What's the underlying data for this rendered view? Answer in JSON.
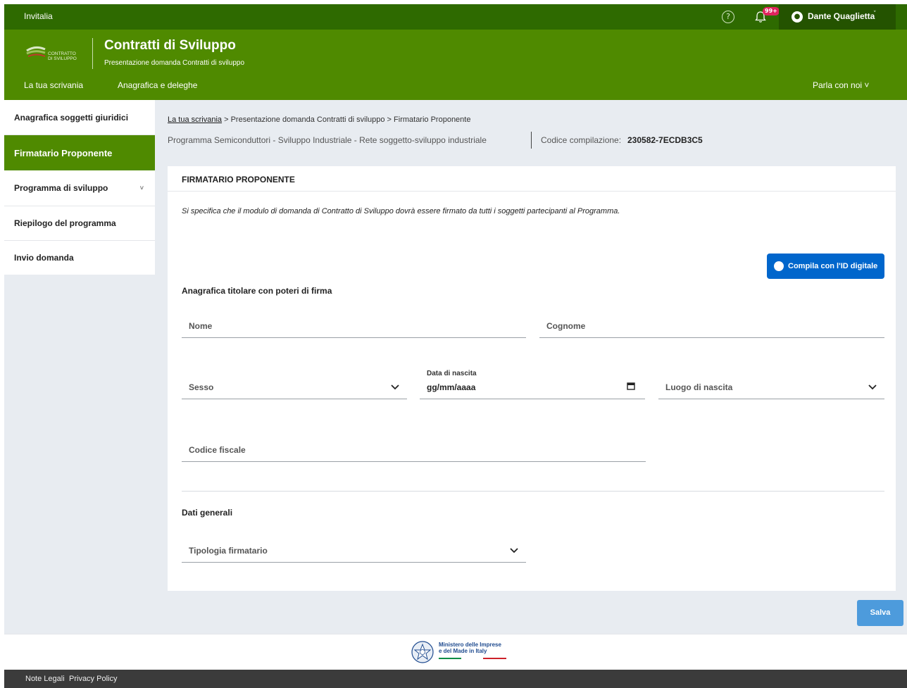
{
  "topbar": {
    "brand": "Invitalia",
    "help_glyph": "?",
    "notifications_badge": "99+",
    "user_name": "Dante Quaglietta",
    "user_chevron": "˅"
  },
  "header": {
    "logo_text_1": "CONTRATTO",
    "logo_text_2": "DI SVILUPPO",
    "title": "Contratti di Sviluppo",
    "subtitle": "Presentazione domanda Contratti di sviluppo",
    "nav": [
      "La tua scrivania",
      "Anagrafica e deleghe"
    ],
    "parla": "Parla con noi  ˅"
  },
  "sidebar": {
    "items": [
      {
        "label": "Anagrafica soggetti giuridici",
        "active": false
      },
      {
        "label": "Firmatario Proponente",
        "active": true
      },
      {
        "label": "Programma di sviluppo",
        "active": false,
        "chevron": "˅"
      },
      {
        "label": "Riepilogo del programma",
        "active": false
      },
      {
        "label": "Invio domanda",
        "active": false
      }
    ]
  },
  "breadcrumb": {
    "home": "La tua scrivania",
    "rest": " >  Presentazione domanda Contratti di sviluppo  >  Firmatario Proponente"
  },
  "info": {
    "program": "Programma Semiconduttori - Sviluppo Industriale   -  Rete soggetto-sviluppo industriale",
    "code_label": "Codice compilazione:",
    "code_value": "230582-7ECDB3C5"
  },
  "card": {
    "title": "FIRMATARIO PROPONENTE",
    "note": "Si specifica che il modulo di domanda di Contratto di Sviluppo dovrà essere firmato da tutti i soggetti partecipanti al Programma.",
    "id_button": "Compila con l'ID digitale",
    "section1": "Anagrafica titolare con poteri di firma",
    "fields": {
      "nome": "Nome",
      "cognome": "Cognome",
      "sesso": "Sesso",
      "data_label": "Data di nascita",
      "data_value": "gg/mm/aaaa",
      "luogo": "Luogo di nascita",
      "codice_fiscale": "Codice fiscale"
    },
    "section2": "Dati generali",
    "tipologia": "Tipologia firmatario"
  },
  "actions": {
    "save": "Salva"
  },
  "footer": {
    "ministry_line1": "Ministero delle Imprese",
    "ministry_line2": "e del Made in Italy",
    "links": [
      "Note Legali",
      "Privacy Policy"
    ]
  }
}
